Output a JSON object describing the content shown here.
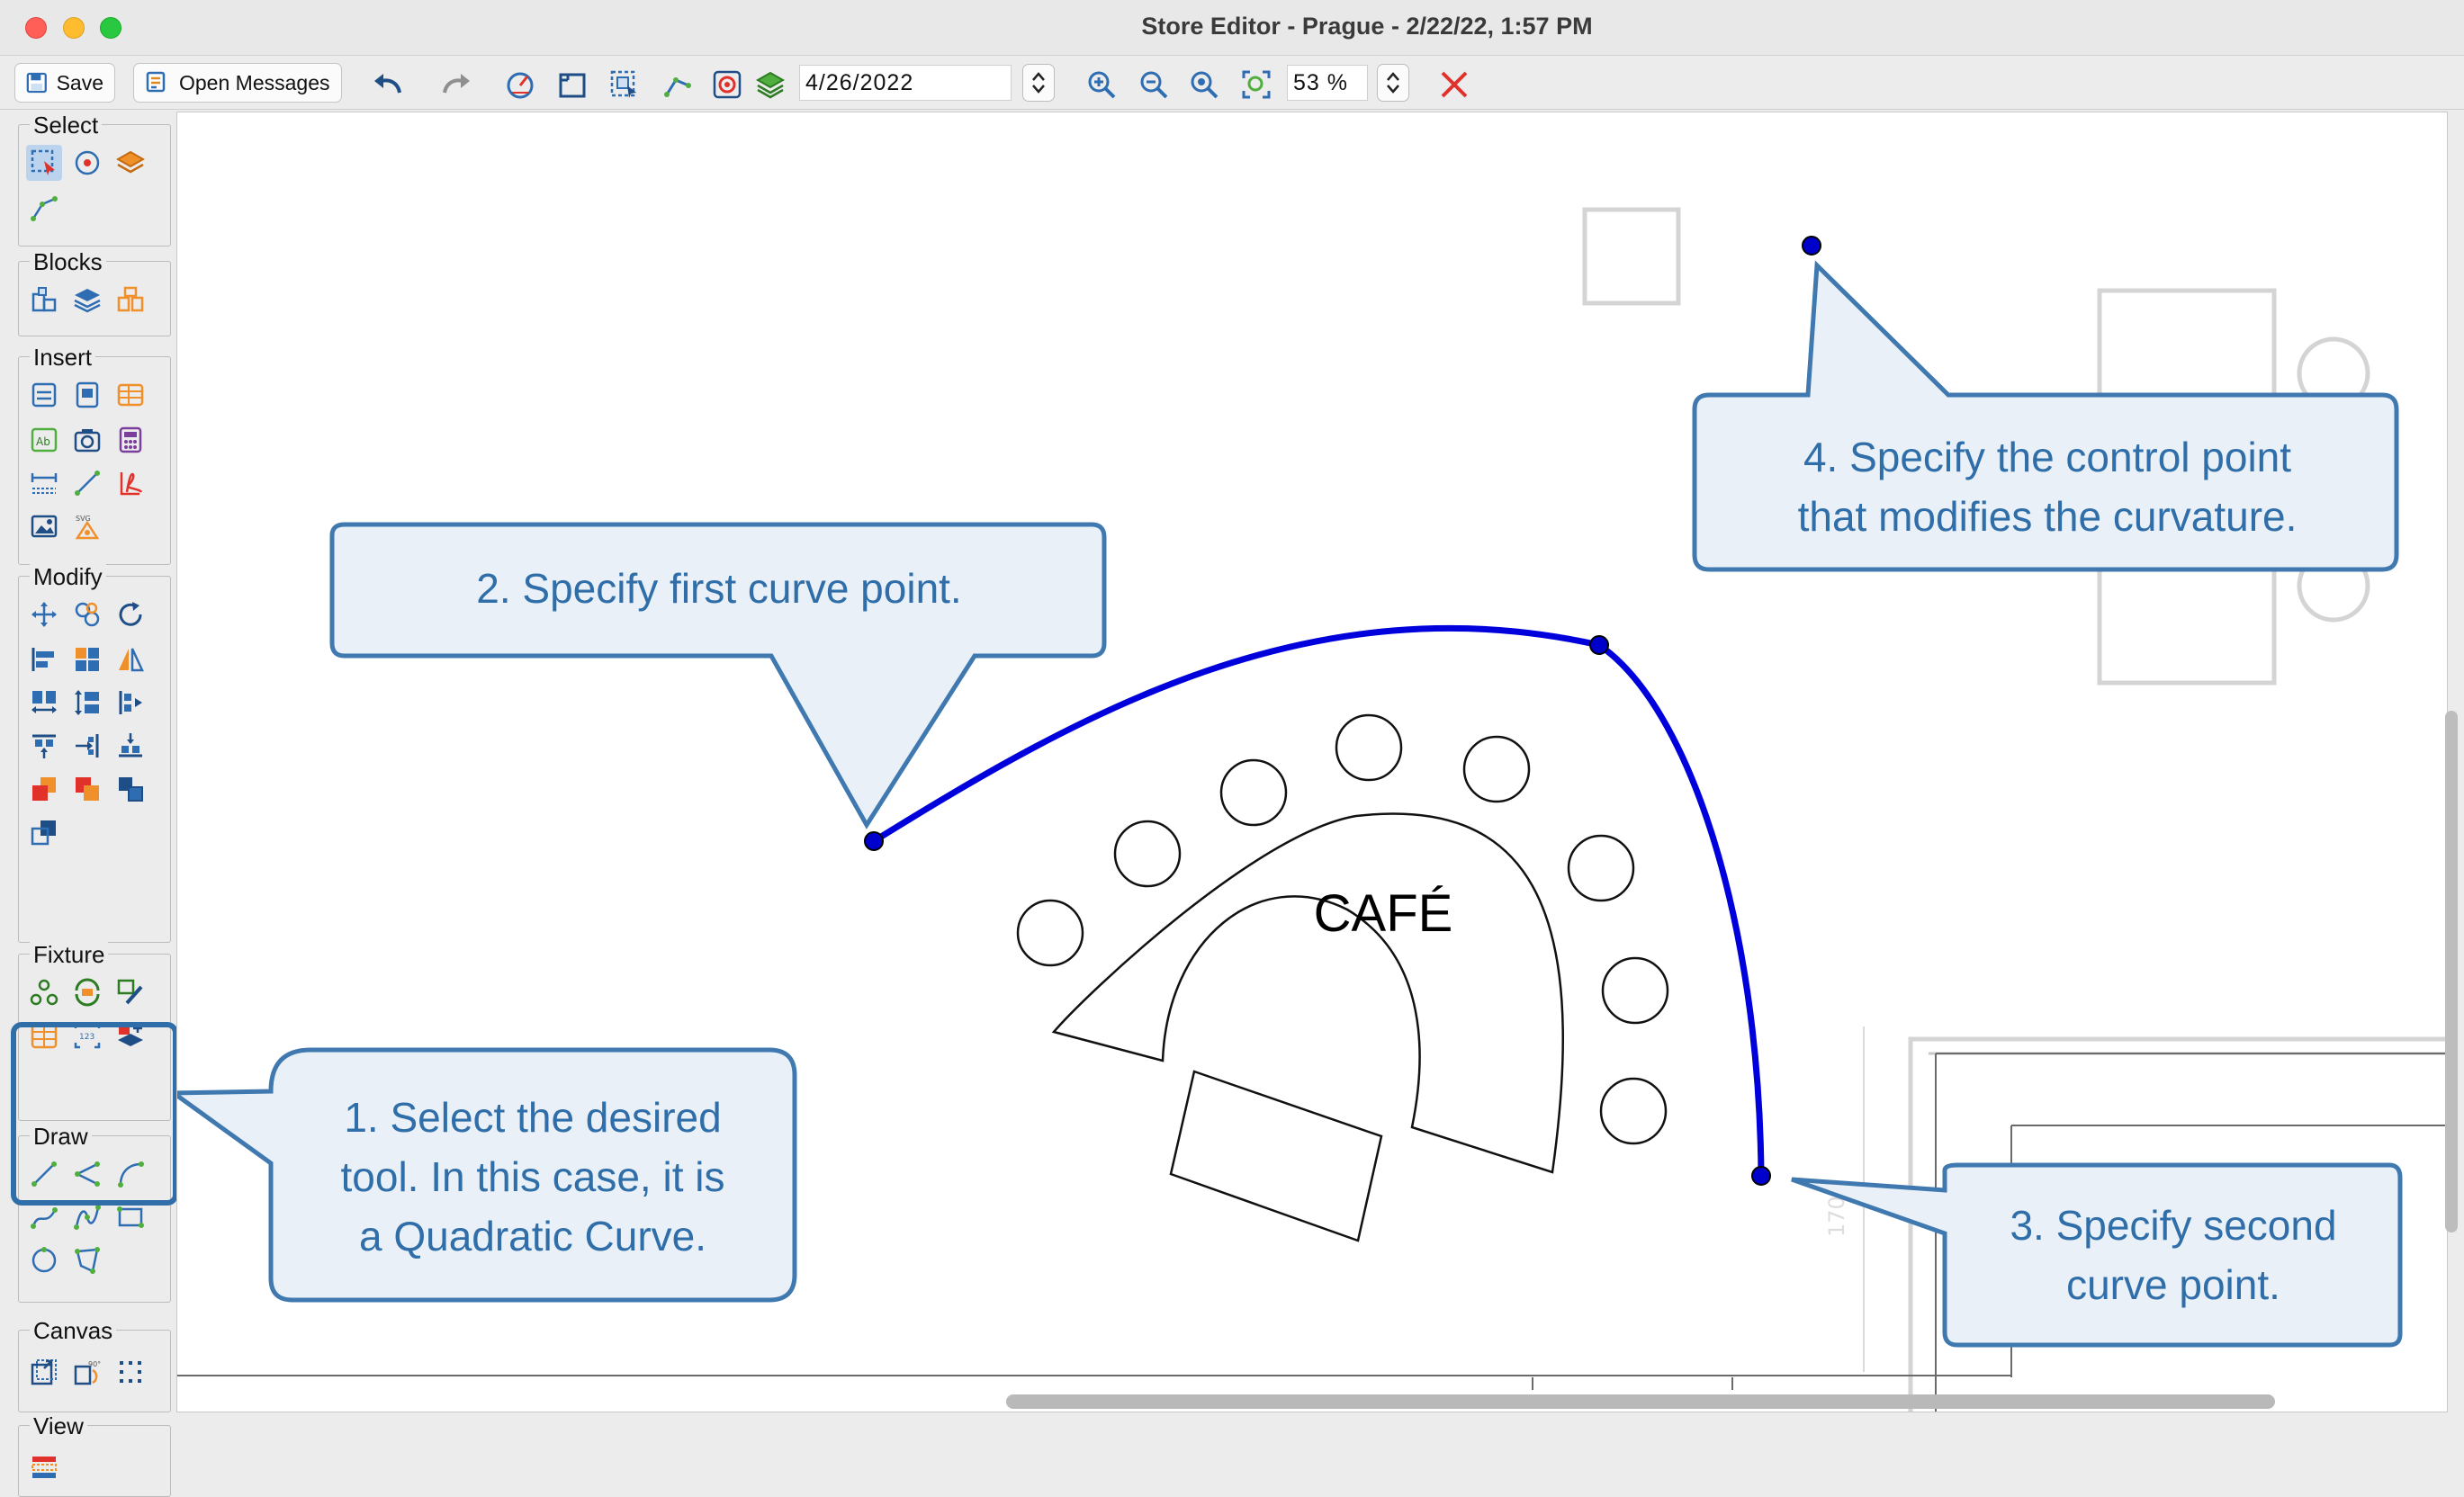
{
  "window": {
    "title": "Store Editor - Prague - 2/22/22, 1:57 PM"
  },
  "toolbar": {
    "save_label": "Save",
    "open_messages_label": "Open Messages",
    "date_value": "4/26/2022",
    "zoom_value": "53 %",
    "icons": [
      "undo-icon",
      "redo-icon",
      "timer-icon",
      "frame-icon",
      "layers-select-icon",
      "points-icon",
      "target-icon",
      "stack-icon",
      "zoom-in-icon",
      "zoom-out-icon",
      "zoom-fit-icon",
      "zoom-select-icon",
      "close-icon"
    ]
  },
  "palette": {
    "groups": [
      {
        "title": "Select"
      },
      {
        "title": "Blocks"
      },
      {
        "title": "Insert"
      },
      {
        "title": "Modify"
      },
      {
        "title": "Fixture"
      },
      {
        "title": "Draw"
      },
      {
        "title": "Canvas"
      },
      {
        "title": "View"
      }
    ]
  },
  "canvas": {
    "cafe_label": "CAFÉ",
    "dimension_label": "1700"
  },
  "callouts": {
    "step1": [
      "1. Select the desired",
      "tool. In this case, it is",
      "a Quadratic Curve."
    ],
    "step2": [
      "2. Specify first curve point."
    ],
    "step3": [
      "3. Specify second",
      "curve point."
    ],
    "step4": [
      "4. Specify the control point",
      "that modifies the curvature."
    ]
  },
  "colors": {
    "callout_fill": "#e9f0f7",
    "callout_stroke": "#3f79b0",
    "callout_text": "#2f6ea8",
    "curve": "#0000dd"
  }
}
